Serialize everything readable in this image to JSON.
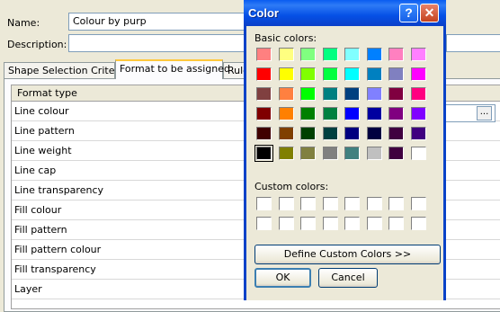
{
  "form": {
    "name_label": "Name:",
    "name_value": "Colour by purp",
    "description_label": "Description:",
    "description_value": "",
    "tabs": [
      {
        "label": "Shape Selection Criteria"
      },
      {
        "label": "Format to be assigned"
      },
      {
        "label": "Rule"
      }
    ],
    "grid_header": "Format type",
    "rows": [
      "Line colour",
      "Line pattern",
      "Line weight",
      "Line cap",
      "Line transparency",
      "Fill colour",
      "Fill pattern",
      "Fill pattern colour",
      "Fill transparency",
      "Layer"
    ],
    "ellipsis_label": "..."
  },
  "dialog": {
    "title": "Color",
    "help_label": "?",
    "close_label": "✕",
    "basic_label": "Basic colors:",
    "custom_label": "Custom colors:",
    "define_label": "Define Custom Colors >>",
    "ok_label": "OK",
    "cancel_label": "Cancel",
    "basic_colors": [
      [
        "#ff8080",
        "#ffff80",
        "#80ff80",
        "#00ff80",
        "#80ffff",
        "#0080ff",
        "#ff80c0",
        "#ff80ff"
      ],
      [
        "#ff0000",
        "#ffff00",
        "#80ff00",
        "#00ff40",
        "#00ffff",
        "#0080c0",
        "#8080c0",
        "#ff00ff"
      ],
      [
        "#804040",
        "#ff8040",
        "#00ff00",
        "#008080",
        "#004080",
        "#8080ff",
        "#800040",
        "#ff0080"
      ],
      [
        "#800000",
        "#ff8000",
        "#008000",
        "#008040",
        "#0000ff",
        "#0000a0",
        "#800080",
        "#8000ff"
      ],
      [
        "#400000",
        "#804000",
        "#004000",
        "#004040",
        "#000080",
        "#000040",
        "#400040",
        "#400080"
      ],
      [
        "#000000",
        "#808000",
        "#808040",
        "#808080",
        "#408080",
        "#c0c0c0",
        "#400040",
        "#ffffff"
      ]
    ],
    "selected_color": "#000000"
  }
}
